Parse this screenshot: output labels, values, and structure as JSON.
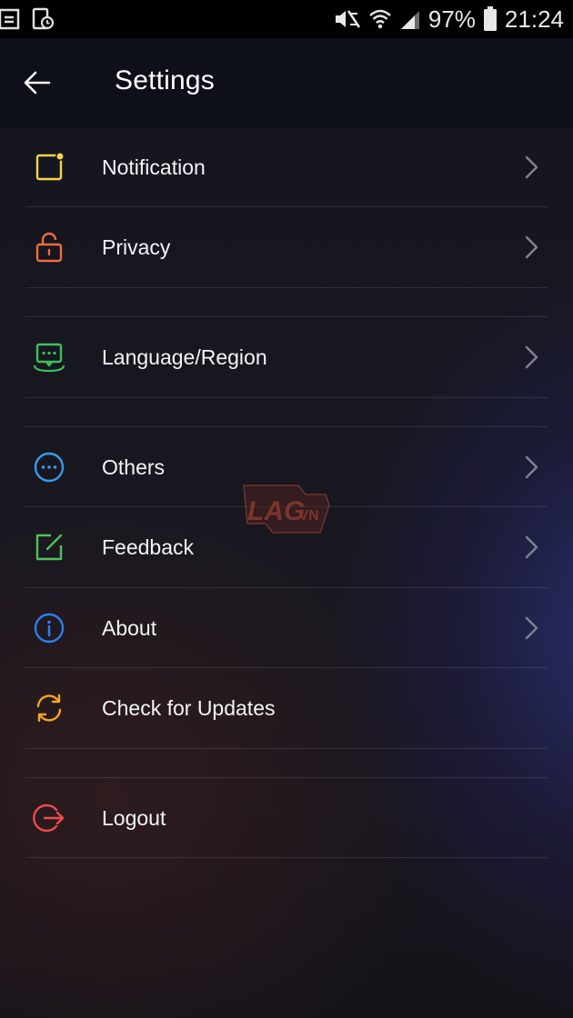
{
  "status_bar": {
    "battery": "97%",
    "time": "21:24",
    "icons": [
      "sim-icon",
      "screenshot-icon",
      "mute-icon",
      "wifi-icon",
      "signal-icon",
      "battery-icon"
    ]
  },
  "header": {
    "title": "Settings",
    "back_icon": "arrow-left-icon"
  },
  "menu": {
    "notification": {
      "label": "Notification",
      "icon": "notification-square-icon",
      "color": "#f5d547"
    },
    "privacy": {
      "label": "Privacy",
      "icon": "unlock-icon",
      "color": "#f26a3d"
    },
    "language": {
      "label": "Language/Region",
      "icon": "chat-bubble-icon",
      "color": "#3fbf5a"
    },
    "others": {
      "label": "Others",
      "icon": "more-circle-icon",
      "color": "#3b9ae8"
    },
    "feedback": {
      "label": "Feedback",
      "icon": "edit-square-icon",
      "color": "#4dc35a"
    },
    "about": {
      "label": "About",
      "icon": "info-circle-icon",
      "color": "#2d7ff0"
    },
    "updates": {
      "label": "Check for Updates",
      "icon": "refresh-icon",
      "color": "#f5a524"
    },
    "logout": {
      "label": "Logout",
      "icon": "logout-icon",
      "color": "#ef4b4b"
    }
  },
  "watermark": {
    "text_main": "LAG",
    "text_suffix": ".VN"
  }
}
